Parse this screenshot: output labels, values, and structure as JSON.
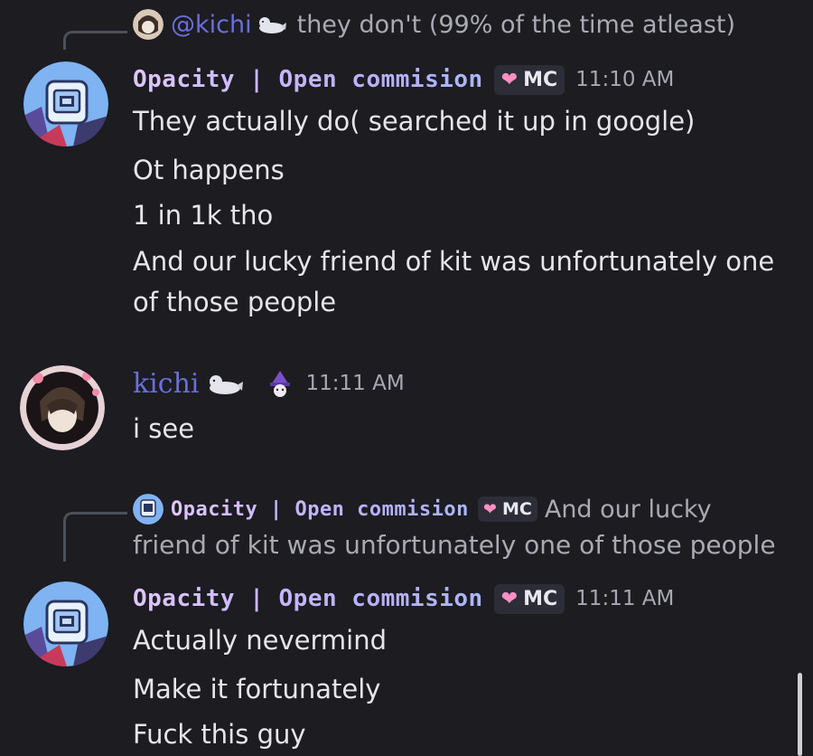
{
  "reply1": {
    "mention": "@kichi",
    "text": "they don't (99% of the time atleast)"
  },
  "message1": {
    "username": "Opacity | Open commision",
    "tag": "MC",
    "timestamp": "11:10 AM",
    "lines": [
      "They actually do( searched it up in google)",
      "Ot happens",
      "1 in 1k tho",
      "And our lucky friend of kit was unfortunately one",
      "of those people"
    ]
  },
  "message2": {
    "username": "kichi",
    "timestamp": "11:11 AM",
    "lines": [
      "i see"
    ]
  },
  "reply2": {
    "username": "Opacity | Open commision",
    "tag": "MC",
    "text_line1": "And our lucky",
    "text_line2": "friend of kit was unfortunately one of those people"
  },
  "message3": {
    "username": "Opacity | Open commision",
    "tag": "MC",
    "timestamp": "11:11 AM",
    "lines": [
      "Actually nevermind",
      "Make it fortunately",
      "Fuck this guy"
    ]
  },
  "colors": {
    "background": "#1c1c21",
    "mention": "#6b6fd8",
    "heart": "#ff8fc4"
  }
}
